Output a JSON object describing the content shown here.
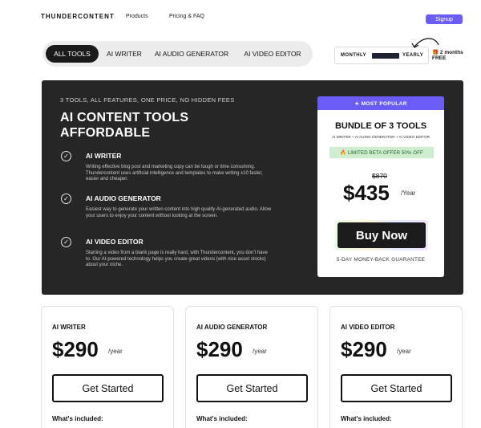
{
  "nav": {
    "brand": "THUNDERCONTENT",
    "links": [
      "Products",
      "Pricing & FAQ"
    ],
    "signup_label": "Signup",
    "accent": "#6b5cf5"
  },
  "tabs": [
    "ALL TOOLS",
    "AI WRITER",
    "AI AUDIO GENERATOR",
    "AI VIDEO EDITOR"
  ],
  "billing": {
    "monthly": "MONTHLY",
    "yearly": "YEARLY",
    "promo_line1": "2 months",
    "promo_line2": "FREE",
    "promo_icon": "gift-icon"
  },
  "hero": {
    "tagline": "3 TOOLS, ALL FEATURES, ONE PRICE, NO HIDDEN FEES",
    "title": "AI CONTENT TOOLS AFFORDABLE",
    "features": [
      {
        "title": "AI WRITER",
        "text": "Writing effective blog post and marketing copy can be tough or time consuming. Thundercontent uses artificial intelligence and templates to make writing x10 faster, easier and cheaper."
      },
      {
        "title": "AI AUDIO GENERATOR",
        "text": "Easiest way to generate your written content into high quality AI-generated audio. Allow your users to enjoy your content without looking at the screen."
      },
      {
        "title": "AI VIDEO EDITOR",
        "text": "Starting a video from a blank page is really hard, with Thundercontent, you don't have to. Our AI-powered technology helps you create great videos (with nice asset stocks) about your niche."
      }
    ]
  },
  "bundle": {
    "badge": "★ MOST POPULAR",
    "title": "BUNDLE OF 3 TOOLS",
    "subtitle": "AI WRITER + AI AUDIO GENERATOR + AI VIDEO EDITOR",
    "offer": "🔥 LIMITED BETA OFFER 50% OFF",
    "old_price": "$870",
    "price": "$435",
    "per": "/Year",
    "cta": "Buy Now",
    "guarantee": "5-DAY MONEY-BACK GUARANTEE"
  },
  "cards": [
    {
      "name": "AI WRITER",
      "price": "$290",
      "per": "/year",
      "cta": "Get Started",
      "included": "What's included:"
    },
    {
      "name": "AI AUDIO GENERATOR",
      "price": "$290",
      "per": "/year",
      "cta": "Get Started",
      "included": "What's included:"
    },
    {
      "name": "AI VIDEO EDITOR",
      "price": "$290",
      "per": "/year",
      "cta": "Get Started",
      "included": "What's included:"
    }
  ]
}
